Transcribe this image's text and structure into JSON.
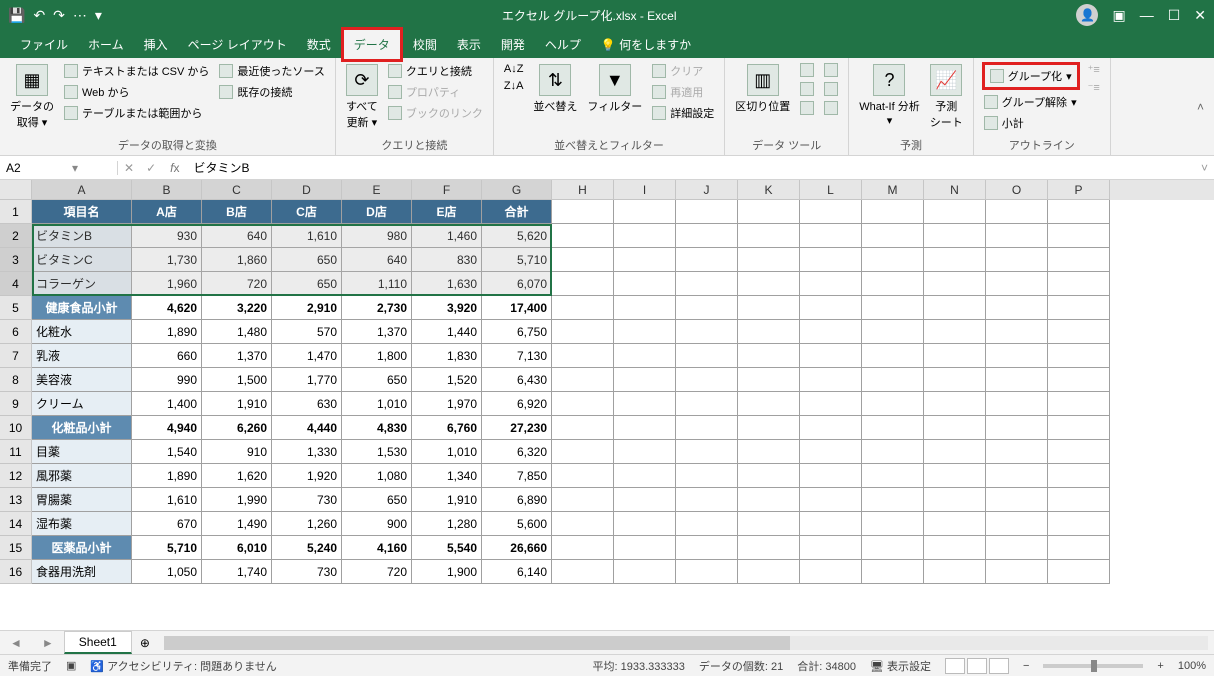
{
  "app": {
    "title": "エクセル グループ化.xlsx - Excel"
  },
  "tabs": {
    "file": "ファイル",
    "home": "ホーム",
    "insert": "挿入",
    "layout": "ページ レイアウト",
    "formulas": "数式",
    "data": "データ",
    "review": "校閲",
    "view": "表示",
    "developer": "開発",
    "help": "ヘルプ",
    "tellme": "何をしますか"
  },
  "ribbon": {
    "get": {
      "title": "データの取得と変換",
      "big": "データの\n取得 ▾",
      "txt_csv": "テキストまたは CSV から",
      "web": "Web から",
      "table": "テーブルまたは範囲から",
      "recent": "最近使ったソース",
      "existing": "既存の接続"
    },
    "query": {
      "title": "クエリと接続",
      "big": "すべて\n更新 ▾",
      "conn": "クエリと接続",
      "prop": "プロパティ",
      "links": "ブックのリンク"
    },
    "sort": {
      "title": "並べ替えとフィルター",
      "az": "A↓Z",
      "za": "Z↓A",
      "sort": "並べ替え",
      "filter": "フィルター",
      "clear": "クリア",
      "reapply": "再適用",
      "adv": "詳細設定"
    },
    "tools": {
      "title": "データ ツール",
      "ttc": "区切り位置"
    },
    "forecast": {
      "title": "予測",
      "whatif": "What-If 分析\n▾",
      "sheet": "予測\nシート"
    },
    "outline": {
      "title": "アウトライン",
      "group": "グループ化",
      "ungroup": "グループ解除",
      "subtotal": "小計"
    }
  },
  "namebox": "A2",
  "formula": "ビタミンB",
  "columns": [
    "A",
    "B",
    "C",
    "D",
    "E",
    "F",
    "G",
    "H",
    "I",
    "J",
    "K",
    "L",
    "M",
    "N",
    "O",
    "P"
  ],
  "headers": [
    "項目名",
    "A店",
    "B店",
    "C店",
    "D店",
    "E店",
    "合計"
  ],
  "chart_data": {
    "type": "table",
    "rows": [
      {
        "label": "ビタミンB",
        "vals": [
          930,
          640,
          1610,
          980,
          1460,
          5620
        ],
        "kind": "data"
      },
      {
        "label": "ビタミンC",
        "vals": [
          1730,
          1860,
          650,
          640,
          830,
          5710
        ],
        "kind": "data"
      },
      {
        "label": "コラーゲン",
        "vals": [
          1960,
          720,
          650,
          1110,
          1630,
          6070
        ],
        "kind": "data"
      },
      {
        "label": "健康食品小計",
        "vals": [
          4620,
          3220,
          2910,
          2730,
          3920,
          17400
        ],
        "kind": "sub"
      },
      {
        "label": "化粧水",
        "vals": [
          1890,
          1480,
          570,
          1370,
          1440,
          6750
        ],
        "kind": "data"
      },
      {
        "label": "乳液",
        "vals": [
          660,
          1370,
          1470,
          1800,
          1830,
          7130
        ],
        "kind": "data"
      },
      {
        "label": "美容液",
        "vals": [
          990,
          1500,
          1770,
          650,
          1520,
          6430
        ],
        "kind": "data"
      },
      {
        "label": "クリーム",
        "vals": [
          1400,
          1910,
          630,
          1010,
          1970,
          6920
        ],
        "kind": "data"
      },
      {
        "label": "化粧品小計",
        "vals": [
          4940,
          6260,
          4440,
          4830,
          6760,
          27230
        ],
        "kind": "sub"
      },
      {
        "label": "目薬",
        "vals": [
          1540,
          910,
          1330,
          1530,
          1010,
          6320
        ],
        "kind": "data"
      },
      {
        "label": "風邪薬",
        "vals": [
          1890,
          1620,
          1920,
          1080,
          1340,
          7850
        ],
        "kind": "data"
      },
      {
        "label": "胃腸薬",
        "vals": [
          1610,
          1990,
          730,
          650,
          1910,
          6890
        ],
        "kind": "data"
      },
      {
        "label": "湿布薬",
        "vals": [
          670,
          1490,
          1260,
          900,
          1280,
          5600
        ],
        "kind": "data"
      },
      {
        "label": "医薬品小計",
        "vals": [
          5710,
          6010,
          5240,
          4160,
          5540,
          26660
        ],
        "kind": "sub"
      },
      {
        "label": "食器用洗剤",
        "vals": [
          1050,
          1740,
          730,
          720,
          1900,
          6140
        ],
        "kind": "data"
      }
    ]
  },
  "sheet": {
    "name": "Sheet1"
  },
  "status": {
    "ready": "準備完了",
    "acc": "アクセシビリティ: 問題ありません",
    "avg_l": "平均:",
    "avg_v": "1933.333333",
    "cnt_l": "データの個数:",
    "cnt_v": "21",
    "sum_l": "合計:",
    "sum_v": "34800",
    "display": "表示設定",
    "zoom": "100%"
  }
}
